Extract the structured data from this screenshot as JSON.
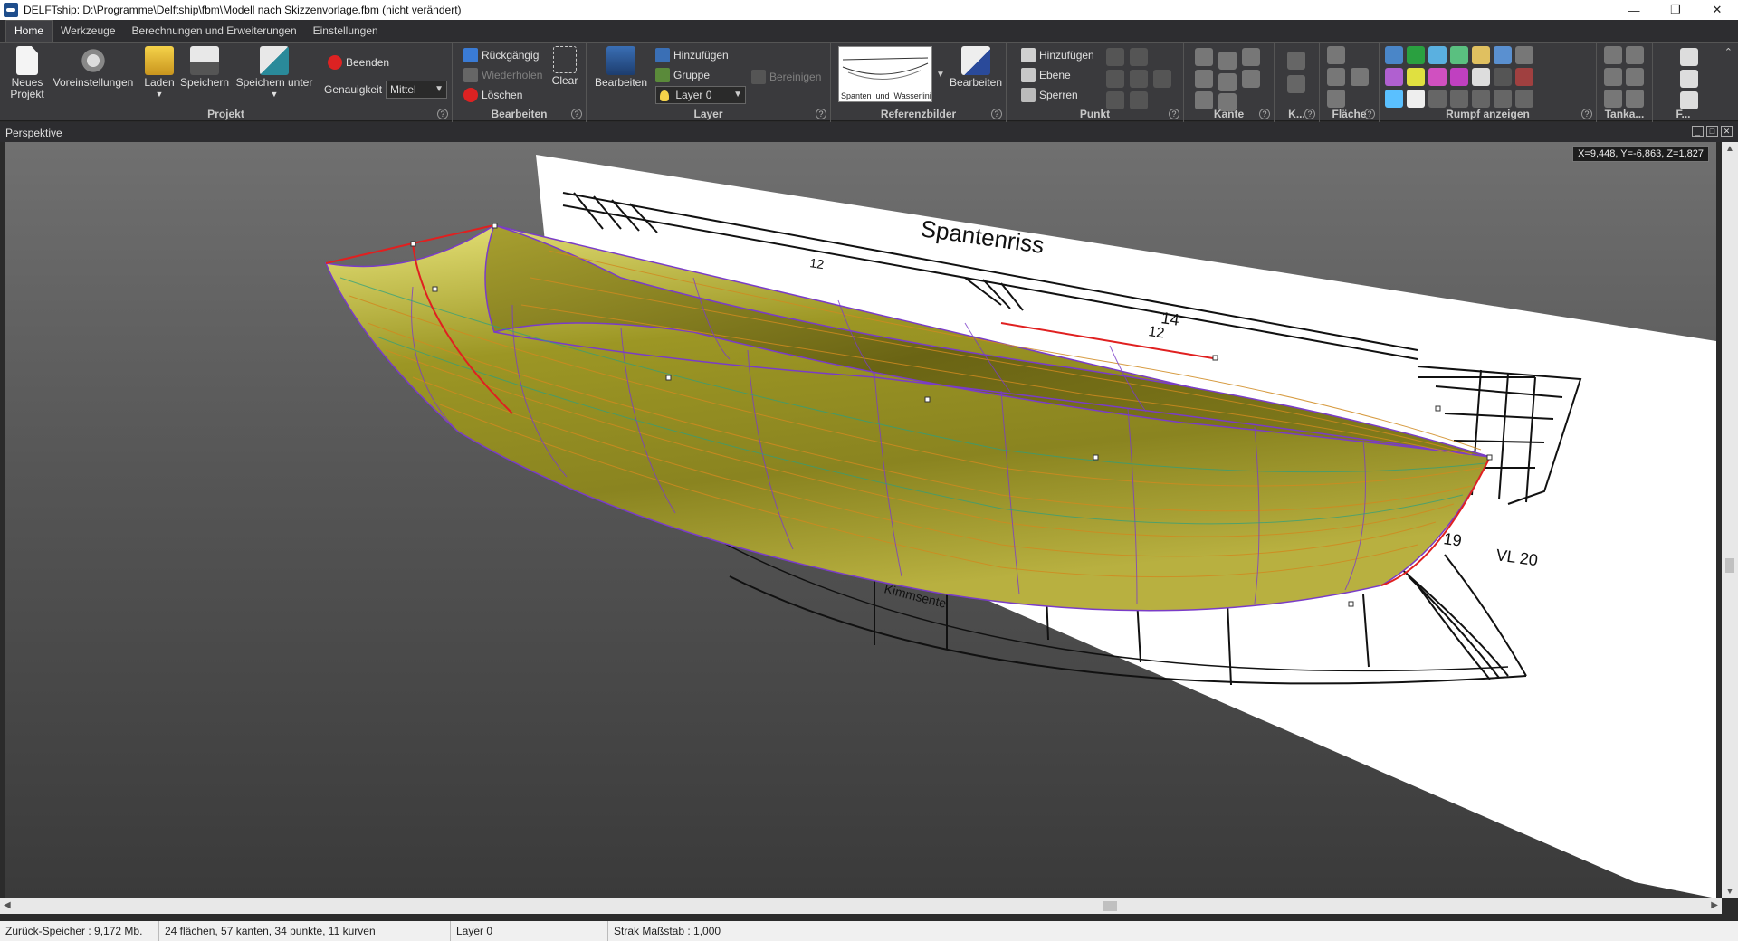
{
  "window": {
    "title": "DELFTship: D:\\Programme\\Delftship\\fbm\\Modell nach Skizzenvorlage.fbm (nicht verändert)",
    "controls": [
      "—",
      "❐",
      "✕"
    ]
  },
  "menu_tabs": [
    {
      "label": "Home",
      "active": true
    },
    {
      "label": "Werkzeuge",
      "active": false
    },
    {
      "label": "Berechnungen und Erweiterungen",
      "active": false
    },
    {
      "label": "Einstellungen",
      "active": false
    }
  ],
  "ribbon": {
    "projekt": {
      "label": "Projekt",
      "neues_projekt": "Neues\nProjekt",
      "voreinstellungen": "Voreinstellungen",
      "laden": "Laden",
      "speichern": "Speichern",
      "speichern_unter": "Speichern unter",
      "beenden": "Beenden",
      "genauigkeit_label": "Genauigkeit",
      "genauigkeit_value": "Mittel"
    },
    "bearbeiten": {
      "label": "Bearbeiten",
      "rueckgaengig": "Rückgängig",
      "wiederholen": "Wiederholen",
      "loeschen": "Löschen",
      "clear": "Clear"
    },
    "layer": {
      "label": "Layer",
      "bearbeiten": "Bearbeiten",
      "hinzufuegen": "Hinzufügen",
      "gruppe": "Gruppe",
      "bereinigen": "Bereinigen",
      "layer_value": "Layer 0"
    },
    "referenzbilder": {
      "label": "Referenzbilder",
      "thumb_caption": "Spanten_und_Wasserlini...",
      "bearbeiten": "Bearbeiten"
    },
    "punkt": {
      "label": "Punkt",
      "hinzufuegen": "Hinzufügen",
      "ebene": "Ebene",
      "sperren": "Sperren"
    },
    "kante": {
      "label": "Kante"
    },
    "k": {
      "label": "K..."
    },
    "flaeche": {
      "label": "Fläche"
    },
    "rumpf": {
      "label": "Rumpf anzeigen"
    },
    "tanka": {
      "label": "Tanka..."
    },
    "f": {
      "label": "F..."
    }
  },
  "viewport": {
    "title": "Perspektive",
    "coords": "X=9,448, Y=-6,863, Z=1,827",
    "drawing_title": "Spantenriss",
    "labels": {
      "n12a": "12",
      "n14": "14",
      "n12b": "12",
      "n19": "19",
      "vl20": "VL 20",
      "kimmsente": "Kimmsente"
    }
  },
  "statusbar": {
    "undo_memory": "Zurück-Speicher : 9,172 Mb.",
    "counts": "24 flächen, 57 kanten, 34 punkte, 11 kurven",
    "layer": "Layer 0",
    "strak": "Strak Maßstab : 1,000"
  },
  "colors": {
    "hull_fill": "#8f8a1f",
    "hull_light": "#d8d46a",
    "grid_orange": "#d08a20",
    "grid_purple": "#7a3cc8",
    "edge_red": "#e02020",
    "grid_green": "#2aa080"
  }
}
